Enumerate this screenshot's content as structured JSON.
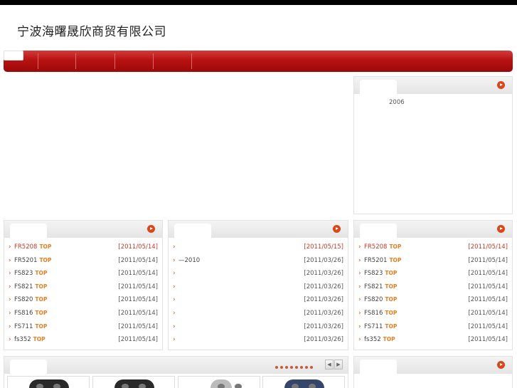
{
  "header": {
    "title": "宁波海曙晟欣商贸有限公司"
  },
  "intro": {
    "year": "2006"
  },
  "left_list": [
    {
      "name": "FR5208",
      "badge": "TOP",
      "date": "[2011/05/14]",
      "highlight": true
    },
    {
      "name": "FR5201",
      "badge": "TOP",
      "date": "[2011/05/14]",
      "highlight": false
    },
    {
      "name": "FS823",
      "badge": "TOP",
      "date": "[2011/05/14]",
      "highlight": false
    },
    {
      "name": "FS821",
      "badge": "TOP",
      "date": "[2011/05/14]",
      "highlight": false
    },
    {
      "name": "FS820",
      "badge": "TOP",
      "date": "[2011/05/14]",
      "highlight": false
    },
    {
      "name": "FS816",
      "badge": "TOP",
      "date": "[2011/05/14]",
      "highlight": false
    },
    {
      "name": "FS711",
      "badge": "TOP",
      "date": "[2011/05/14]",
      "highlight": false
    },
    {
      "name": "fs352",
      "badge": "TOP",
      "date": "[2011/05/14]",
      "highlight": false
    }
  ],
  "news_list": [
    {
      "name": "",
      "date": "[2011/05/15]",
      "highlight": true
    },
    {
      "name": "—2010",
      "date": "[2011/03/26]",
      "highlight": false
    },
    {
      "name": "",
      "date": "[2011/03/26]",
      "highlight": false
    },
    {
      "name": "",
      "date": "[2011/03/26]",
      "highlight": false
    },
    {
      "name": "",
      "date": "[2011/03/26]",
      "highlight": false
    },
    {
      "name": "",
      "date": "[2011/03/26]",
      "highlight": false
    },
    {
      "name": "",
      "date": "[2011/03/26]",
      "highlight": false
    },
    {
      "name": "",
      "date": "[2011/03/26]",
      "highlight": false
    }
  ],
  "right_list": [
    {
      "name": "FR5208",
      "badge": "TOP",
      "date": "[2011/05/14]",
      "highlight": true
    },
    {
      "name": "FR5201",
      "badge": "TOP",
      "date": "[2011/05/14]",
      "highlight": false
    },
    {
      "name": "FS823",
      "badge": "TOP",
      "date": "[2011/05/14]",
      "highlight": false
    },
    {
      "name": "FS821",
      "badge": "TOP",
      "date": "[2011/05/14]",
      "highlight": false
    },
    {
      "name": "FS820",
      "badge": "TOP",
      "date": "[2011/05/14]",
      "highlight": false
    },
    {
      "name": "FS816",
      "badge": "TOP",
      "date": "[2011/05/14]",
      "highlight": false
    },
    {
      "name": "FS711",
      "badge": "TOP",
      "date": "[2011/05/14]",
      "highlight": false
    },
    {
      "name": "fs352",
      "badge": "TOP",
      "date": "[2011/05/14]",
      "highlight": false
    }
  ],
  "pager": {
    "prev": "◀",
    "next": "▶"
  },
  "icons": {
    "more": "circle-arrow-right-icon",
    "bullet": "›"
  }
}
